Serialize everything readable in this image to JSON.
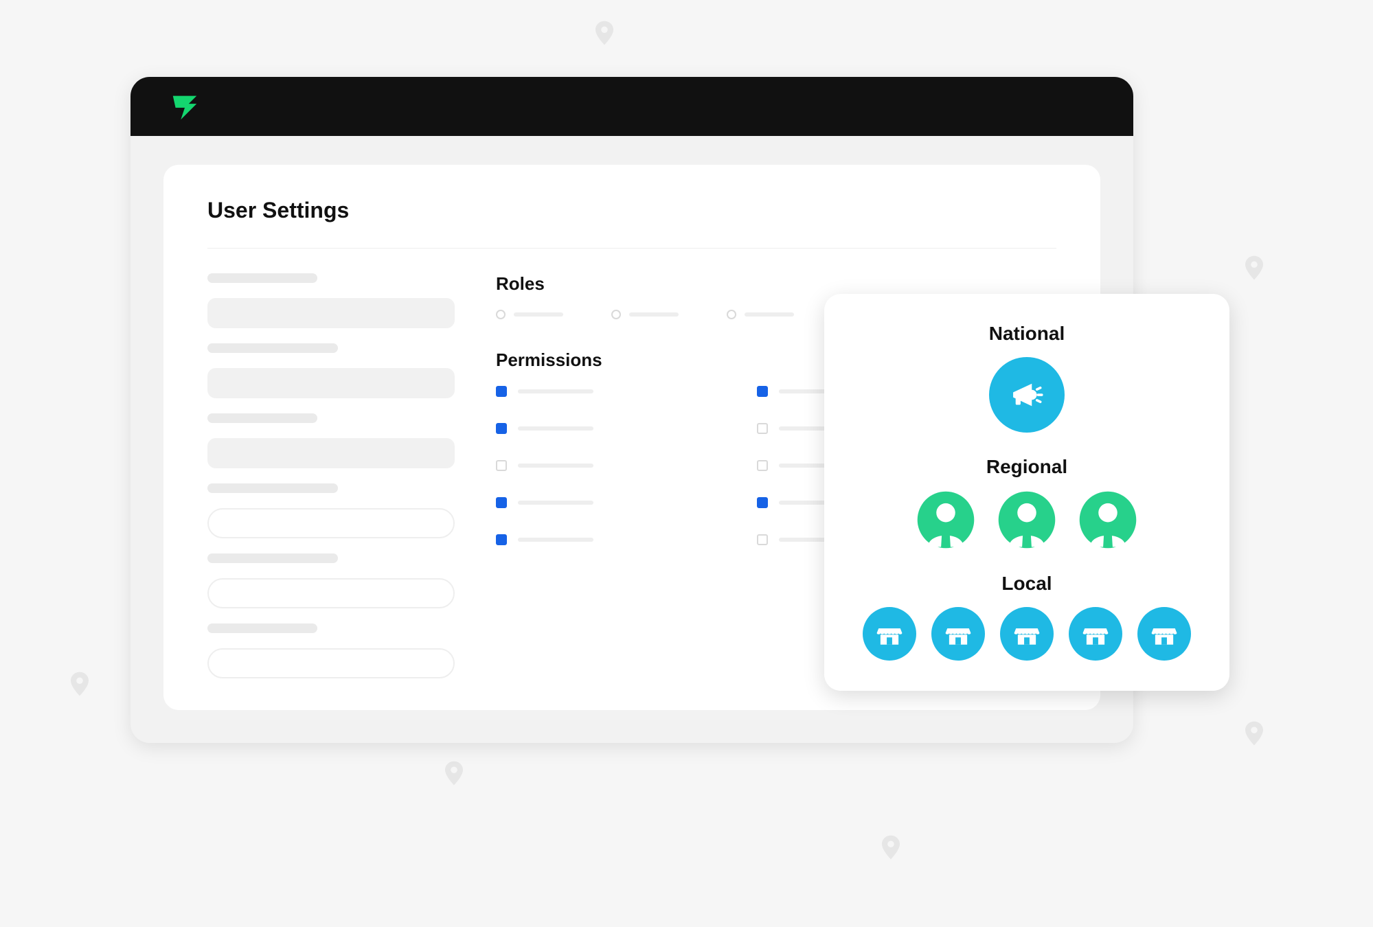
{
  "colors": {
    "brand_green": "#14d66f",
    "brand_blue": "#1fb9e4",
    "avatar_green": "#27d18b",
    "checkbox_blue": "#1662e6"
  },
  "page": {
    "title": "User Settings",
    "sections": {
      "roles_label": "Roles",
      "permissions_label": "Permissions"
    }
  },
  "roles": {
    "options": [
      {
        "selected": false
      },
      {
        "selected": false
      },
      {
        "selected": false
      }
    ]
  },
  "permissions": {
    "items": [
      {
        "checked": true
      },
      {
        "checked": true
      },
      {
        "checked": true
      },
      {
        "checked": false
      },
      {
        "checked": false
      },
      {
        "checked": false
      },
      {
        "checked": true
      },
      {
        "checked": true
      },
      {
        "checked": true
      },
      {
        "checked": false
      }
    ]
  },
  "hierarchy": {
    "tiers": {
      "national_label": "National",
      "regional_label": "Regional",
      "local_label": "Local"
    },
    "regional_count": 3,
    "local_count": 5
  }
}
